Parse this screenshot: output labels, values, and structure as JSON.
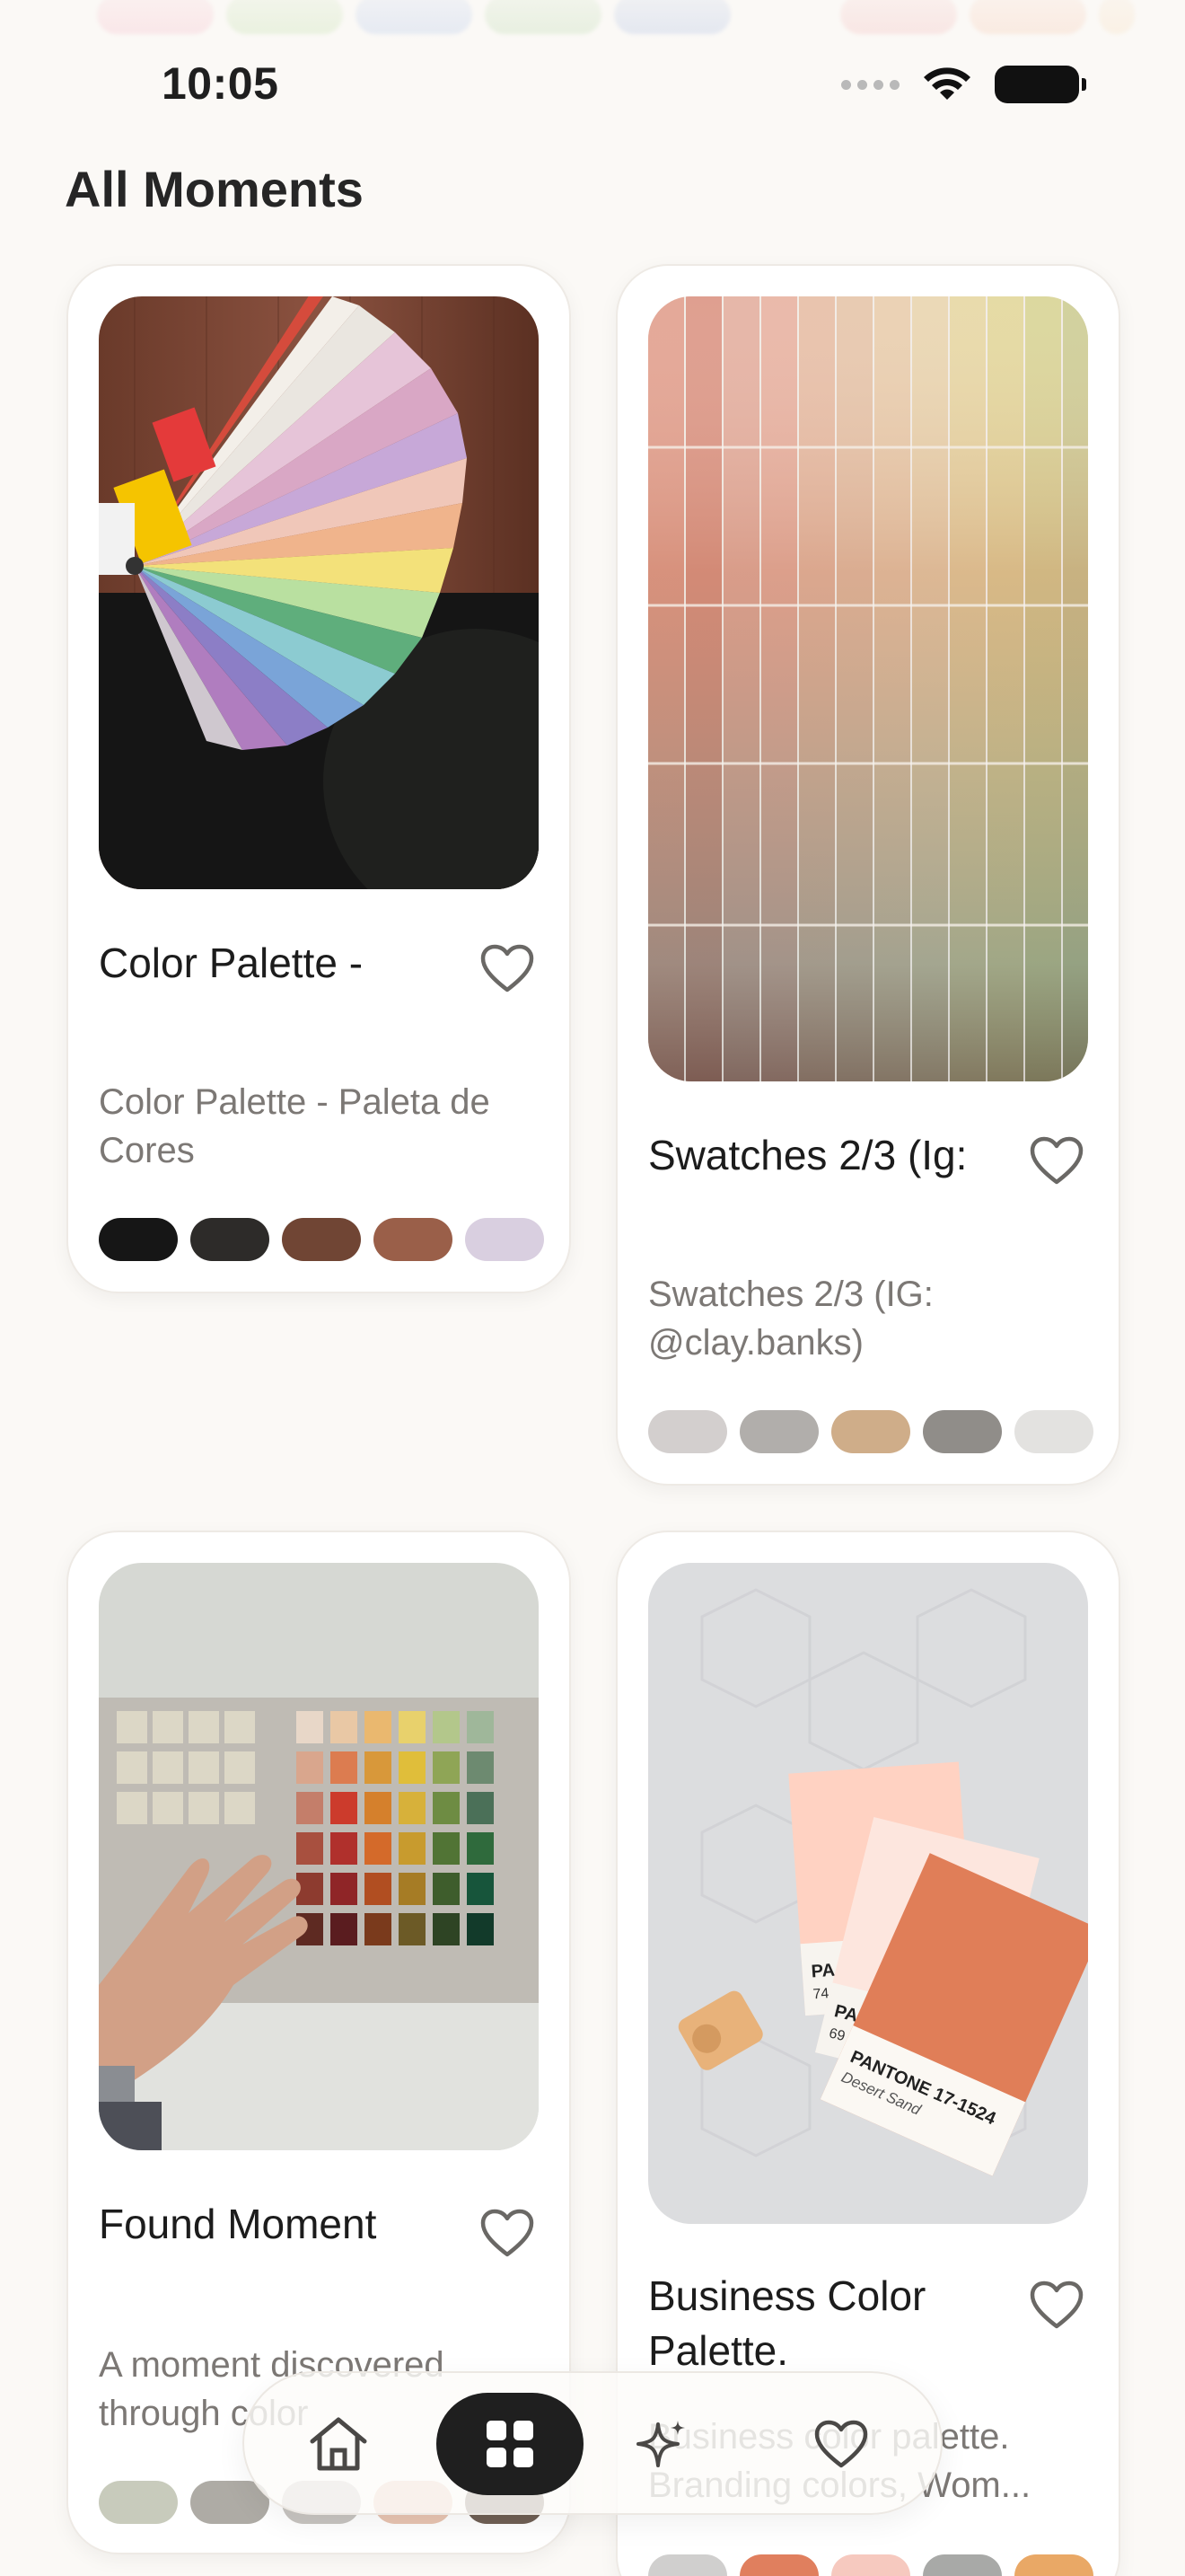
{
  "status_bar": {
    "time": "10:05"
  },
  "page_title": "All Moments",
  "top_chip_colors": [
    "#f2a2b6",
    "#a9d48a",
    "#96b2e4",
    "#9fcb8f",
    "#8ea7da",
    "#f0a0a0",
    "#f2b493",
    "#f4d2a6"
  ],
  "moments": [
    {
      "title": "Color Palette -",
      "description": "Color Palette - Paleta de Cores",
      "image": "fan-deck-color-palette-photo",
      "swatches": [
        "#161616",
        "#2d2b29",
        "#704534",
        "#9a5f49",
        "#d9cfe0"
      ]
    },
    {
      "title": "Swatches 2/3 (Ig:",
      "description": "Swatches 2/3 (IG: @clay.banks)",
      "image": "paint-swatch-wall-photo",
      "swatches": [
        "#d3cfce",
        "#b1aeab",
        "#cfad89",
        "#908d89",
        "#e3e2e0"
      ]
    },
    {
      "title": "Found Moment",
      "description": "A moment discovered through color",
      "image": "hand-on-color-chart-photo",
      "swatches": [
        "#c8cbbc",
        "#aeaba5",
        "#c7c4c0",
        "#e8c4b1",
        "#6f5f54"
      ]
    },
    {
      "title": "Business Color Palette.",
      "description": "Business color palette. Branding colors, Wom...",
      "image": "pantone-cards-photo",
      "pantone_label": "PANTONE 17-1524",
      "pantone_name": "Desert Sand",
      "swatches": [
        "#d0cfce",
        "#e07f5e",
        "#f6c9bf",
        "#a8a9a7",
        "#e9a866"
      ]
    }
  ],
  "bottom_nav": {
    "items": [
      {
        "name": "home",
        "icon": "house-icon"
      },
      {
        "name": "grid",
        "icon": "grid-icon",
        "active": true
      },
      {
        "name": "magic",
        "icon": "sparkles-icon"
      },
      {
        "name": "favorites",
        "icon": "heart-icon"
      }
    ]
  }
}
